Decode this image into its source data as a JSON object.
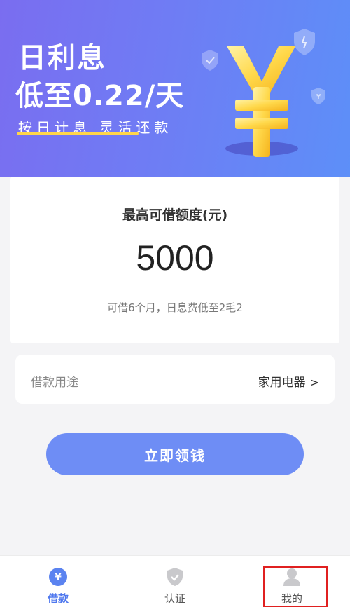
{
  "banner": {
    "title": "日利息",
    "subtitle": "低至0.22/天",
    "tagline": "按日计息 灵活还款",
    "yen_symbol": "¥",
    "accent_color": "#ffd54a"
  },
  "quota": {
    "label": "最高可借额度(元)",
    "amount": "5000",
    "note": "可借6个月，日息费低至2毛2"
  },
  "purpose": {
    "label": "借款用途",
    "value": "家用电器",
    "chevron": ">"
  },
  "primary_button": {
    "label": "立即领钱",
    "color": "#6e8df5"
  },
  "bottom_nav": {
    "items": [
      {
        "label": "借款",
        "icon": "yen-circle-icon",
        "active": true
      },
      {
        "label": "认证",
        "icon": "shield-check-icon",
        "active": false
      },
      {
        "label": "我的",
        "icon": "user-icon",
        "active": false
      }
    ]
  }
}
